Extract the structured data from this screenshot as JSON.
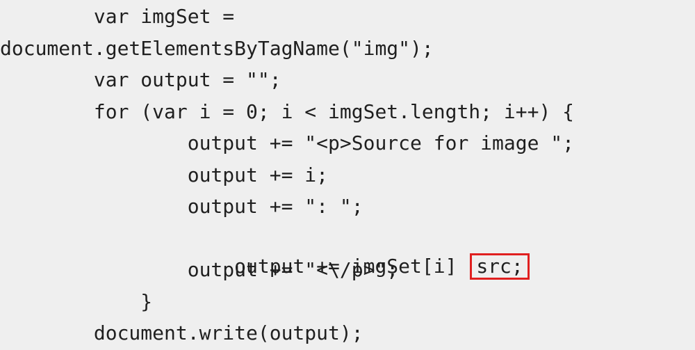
{
  "code": {
    "lines": [
      "        var imgSet =",
      "document.getElementsByTagName(\"img\");",
      "        var output = \"\";",
      "        for (var i = 0; i < imgSet.length; i++) {",
      "                output += \"<p>Source for image \";",
      "                output += i;",
      "                output += \": \";",
      "                output += \"<\\/p>\";",
      "            }",
      "        document.write(output);"
    ],
    "highlight_line": {
      "before": "                output += imgSet[i] ",
      "highlighted": "src;"
    },
    "highlight_color": "#e02020"
  }
}
